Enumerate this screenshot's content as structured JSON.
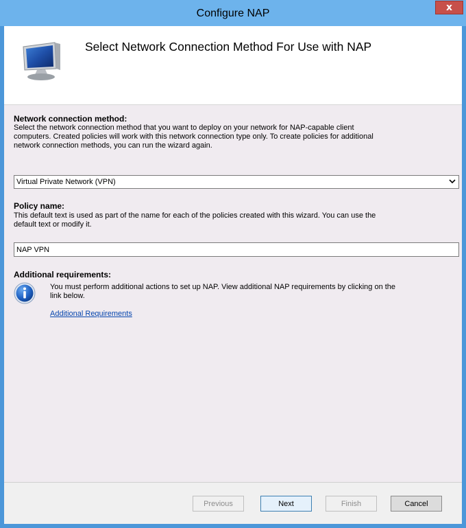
{
  "window": {
    "title": "Configure NAP",
    "close_label": "x"
  },
  "header": {
    "title": "Select Network Connection Method For Use with NAP",
    "icon": "computer-monitor-icon"
  },
  "connection": {
    "label": "Network connection method:",
    "description_lines": [
      "Select the network connection method that you want to deploy on your network for NAP-capable client",
      "computers. Created policies will work with this network connection type only. To create policies for additional",
      "network connection methods, you can run the wizard again."
    ],
    "selected_value": "Virtual Private Network (VPN)"
  },
  "policy": {
    "label": "Policy name:",
    "description_lines": [
      "This default text is used as part of the name for each of the policies created with this wizard. You can use the",
      "default text or modify it."
    ],
    "value": "NAP VPN"
  },
  "requirements": {
    "label": "Additional requirements:",
    "description_lines": [
      "You must perform additional actions to set up NAP. View additional NAP requirements by clicking on the",
      "link below."
    ],
    "link": "Additional Requirements",
    "icon": "info-icon"
  },
  "buttons": {
    "previous": "Previous",
    "next": "Next",
    "finish": "Finish",
    "cancel": "Cancel"
  },
  "colors": {
    "titlebar": "#6db3ec",
    "frame": "#4c97d9",
    "content_bg": "#f0ebf0",
    "link": "#0645ad",
    "close": "#c7504a"
  }
}
